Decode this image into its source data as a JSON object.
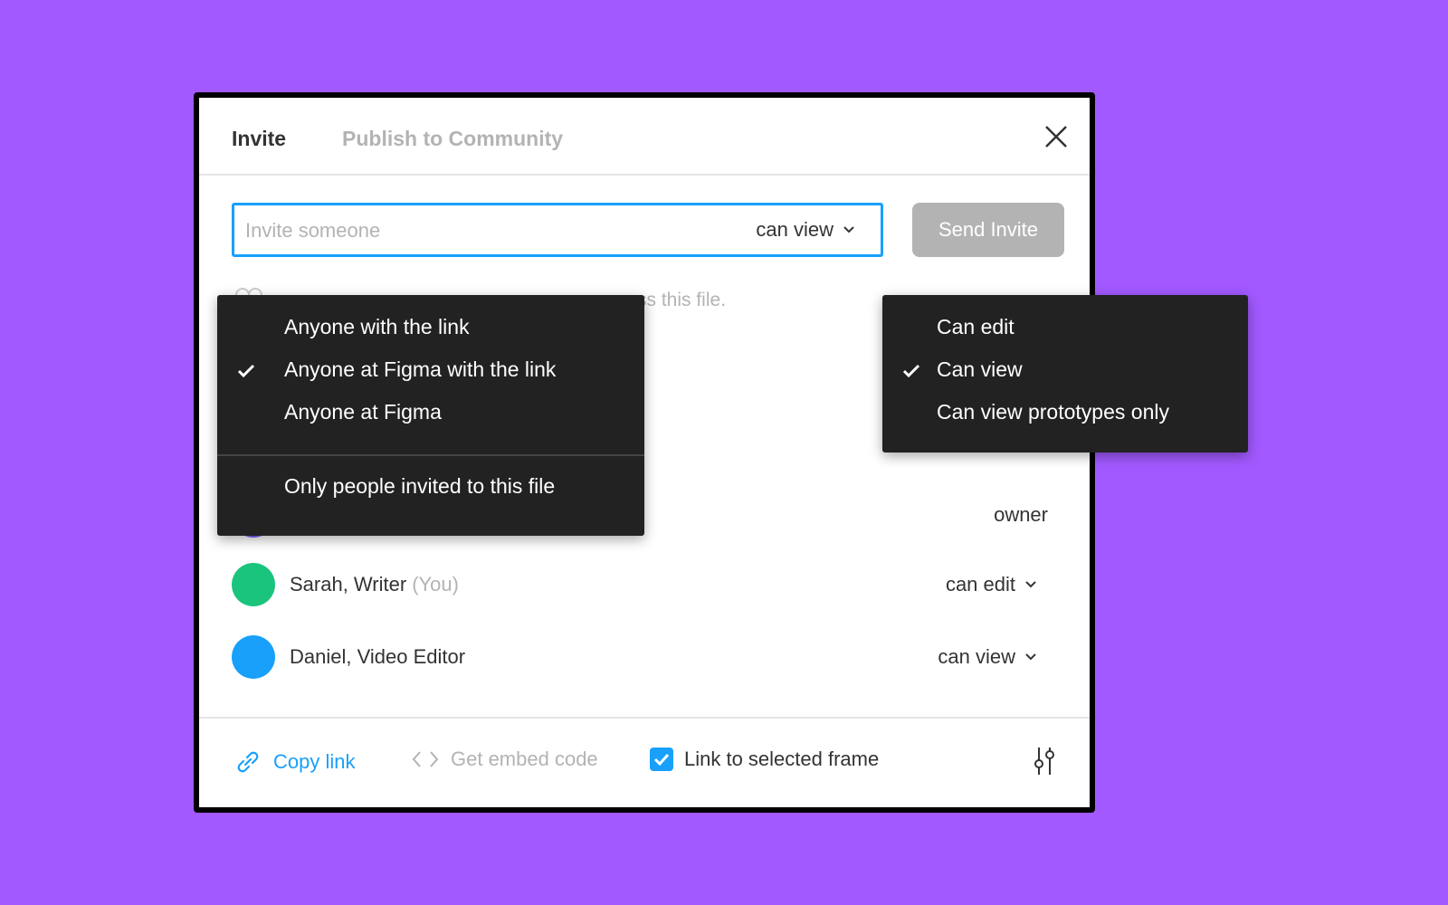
{
  "tabs": [
    {
      "label": "Invite",
      "active": true
    },
    {
      "label": "Publish to Community",
      "active": false
    }
  ],
  "invite": {
    "placeholder": "Invite someone",
    "permission": "can view",
    "send_label": "Send Invite"
  },
  "hidden_text": {
    "link_access_end": "ss this file."
  },
  "owner": {
    "role": "owner"
  },
  "members": [
    {
      "name": "Sarah, Writer",
      "suffix": "(You)",
      "permission": "can edit",
      "color": "#1bc47d"
    },
    {
      "name": "Daniel, Video Editor",
      "suffix": "",
      "permission": "can view",
      "color": "#18a0fb"
    }
  ],
  "footer": {
    "copy_link": "Copy link",
    "embed": "Get embed code",
    "link_frame": "Link to selected frame",
    "link_frame_checked": true
  },
  "link_access_menu": {
    "items": [
      {
        "label": "Anyone with the link",
        "checked": false
      },
      {
        "label": "Anyone at Figma with the link",
        "checked": true
      },
      {
        "label": "Anyone at Figma",
        "checked": false
      },
      {
        "label": "Only people invited to this file",
        "checked": false
      }
    ]
  },
  "permission_menu": {
    "items": [
      {
        "label": "Can edit",
        "checked": false
      },
      {
        "label": "Can view",
        "checked": true
      },
      {
        "label": "Can view prototypes only",
        "checked": false
      }
    ]
  },
  "colors": {
    "background": "#a259ff",
    "accent": "#18a0fb",
    "menu_bg": "#222222",
    "disabled": "#b3b3b3"
  }
}
